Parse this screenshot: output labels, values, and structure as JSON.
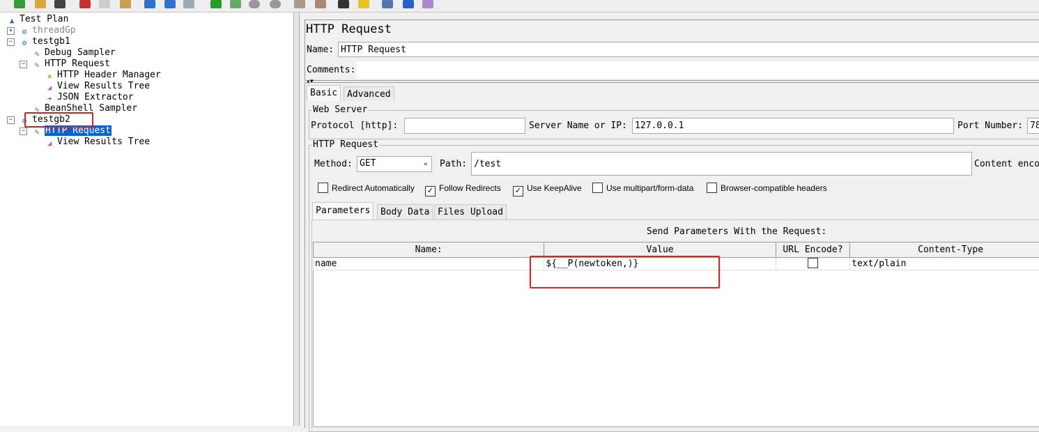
{
  "tree": {
    "items": [
      {
        "label": "Test Plan",
        "icon": "test-plan-icon"
      },
      {
        "label": "threadGp",
        "icon": "thread-group-icon",
        "disabled": true
      },
      {
        "label": "testgb1",
        "icon": "thread-group-icon"
      },
      {
        "label": "Debug Sampler",
        "icon": "sampler-icon"
      },
      {
        "label": "HTTP Request",
        "icon": "sampler-icon"
      },
      {
        "label": "HTTP Header Manager",
        "icon": "wrench-icon"
      },
      {
        "label": "View Results Tree",
        "icon": "listener-icon"
      },
      {
        "label": "JSON Extractor",
        "icon": "extractor-icon"
      },
      {
        "label": "BeanShell Sampler",
        "icon": "sampler-icon"
      },
      {
        "label": "testgb2",
        "icon": "thread-group-icon"
      },
      {
        "label": "HTTP Request",
        "icon": "sampler-icon",
        "selected": true
      },
      {
        "label": "View Results Tree",
        "icon": "listener-icon"
      }
    ]
  },
  "panel": {
    "title": "HTTP Request",
    "name_label": "Name:",
    "name_value": "HTTP Request",
    "comments_label": "Comments:",
    "comments_value": "",
    "tabs": [
      "Basic",
      "Advanced"
    ],
    "web_server": {
      "legend": "Web Server",
      "protocol_label": "Protocol [http]:",
      "protocol_value": "",
      "server_label": "Server Name or IP:",
      "server_value": "127.0.0.1",
      "port_label": "Port Number:",
      "port_value": "78"
    },
    "http_request": {
      "legend": "HTTP Request",
      "method_label": "Method:",
      "method_value": "GET",
      "path_label": "Path:",
      "path_value": "/test",
      "encoding_label": "Content enco"
    },
    "checkboxes": [
      {
        "label": "Redirect Automatically",
        "checked": false
      },
      {
        "label": "Follow Redirects",
        "checked": true
      },
      {
        "label": "Use KeepAlive",
        "checked": true
      },
      {
        "label": "Use multipart/form-data",
        "checked": false
      },
      {
        "label": "Browser-compatible headers",
        "checked": false
      }
    ],
    "subtabs": [
      "Parameters",
      "Body Data",
      "Files Upload"
    ],
    "params_caption": "Send Parameters With the Request:",
    "columns": [
      "Name:",
      "Value",
      "URL Encode?",
      "Content-Type"
    ],
    "rows": [
      {
        "name": "name",
        "value": "${__P(newtoken,)}",
        "encode": false,
        "type": "text/plain"
      }
    ]
  },
  "colors": {
    "selection": "#0a64d0",
    "highlight": "#e02020"
  }
}
